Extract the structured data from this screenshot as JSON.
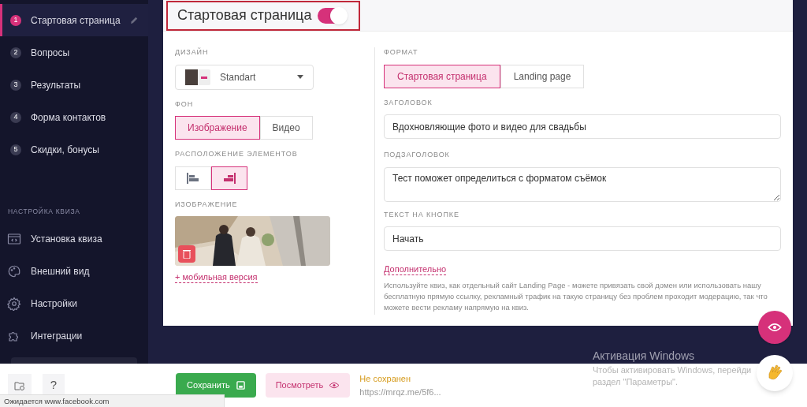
{
  "sidebar": {
    "steps": [
      {
        "number": "1",
        "label": "Стартовая страница",
        "selected": true
      },
      {
        "number": "2",
        "label": "Вопросы",
        "selected": false
      },
      {
        "number": "3",
        "label": "Результаты",
        "selected": false
      },
      {
        "number": "4",
        "label": "Форма контактов",
        "selected": false
      },
      {
        "number": "5",
        "label": "Скидки, бонусы",
        "selected": false
      }
    ],
    "section_title": "НАСТРОЙКА КВИЗА",
    "settings": [
      {
        "kind": "code",
        "label": "Установка квиза"
      },
      {
        "kind": "palette",
        "label": "Внешний вид"
      },
      {
        "kind": "gear",
        "label": "Настройки"
      },
      {
        "kind": "puzzle",
        "label": "Интеграции"
      }
    ],
    "help_button": "?"
  },
  "header": {
    "title": "Стартовая страница",
    "enabled": true
  },
  "left": {
    "design_label": "ДИЗАЙН",
    "design_value": "Standart",
    "background_label": "ФОН",
    "background_options": [
      {
        "label": "Изображение",
        "selected": true
      },
      {
        "label": "Видео",
        "selected": false
      }
    ],
    "layout_label": "РАСПОЛОЖЕНИЕ ЭЛЕМЕНТОВ",
    "layout_options": [
      {
        "kind": "left",
        "selected": false
      },
      {
        "kind": "right",
        "selected": true
      }
    ],
    "image_label": "ИЗОБРАЖЕНИЕ",
    "mobile_link": "+ мобильная версия"
  },
  "right": {
    "format_label": "ФОРМАТ",
    "format_options": [
      {
        "label": "Стартовая страница",
        "selected": true
      },
      {
        "label": "Landing page",
        "selected": false
      }
    ],
    "title_label": "ЗАГОЛОВОК",
    "title_value": "Вдохновляющие фото и видео для свадьбы",
    "subtitle_label": "ПОДЗАГОЛОВОК",
    "subtitle_value": "Тест поможет определиться с форматом съёмок",
    "button_label": "ТЕКСТ НА КНОПКЕ",
    "button_value": "Начать",
    "more_link": "Дополнительно",
    "help_text": "Используйте квиз, как отдельный сайт Landing Page - можете привязать свой домен или использовать нашу бесплатную прямую ссылку, рекламный трафик на такую страницу без проблем проходит модерацию, так что можете вести рекламу напрямую на квиз."
  },
  "footer": {
    "save": "Сохранить",
    "preview": "Посмотреть",
    "status": "Не сохранен",
    "url": "https://mrqz.me/5f6..."
  },
  "windows": {
    "title": "Активация Windows",
    "line1": "Чтобы активировать Windows, перейди",
    "line2": "раздел \"Параметры\"."
  },
  "browser_status": "Ожидается www.facebook.com"
}
